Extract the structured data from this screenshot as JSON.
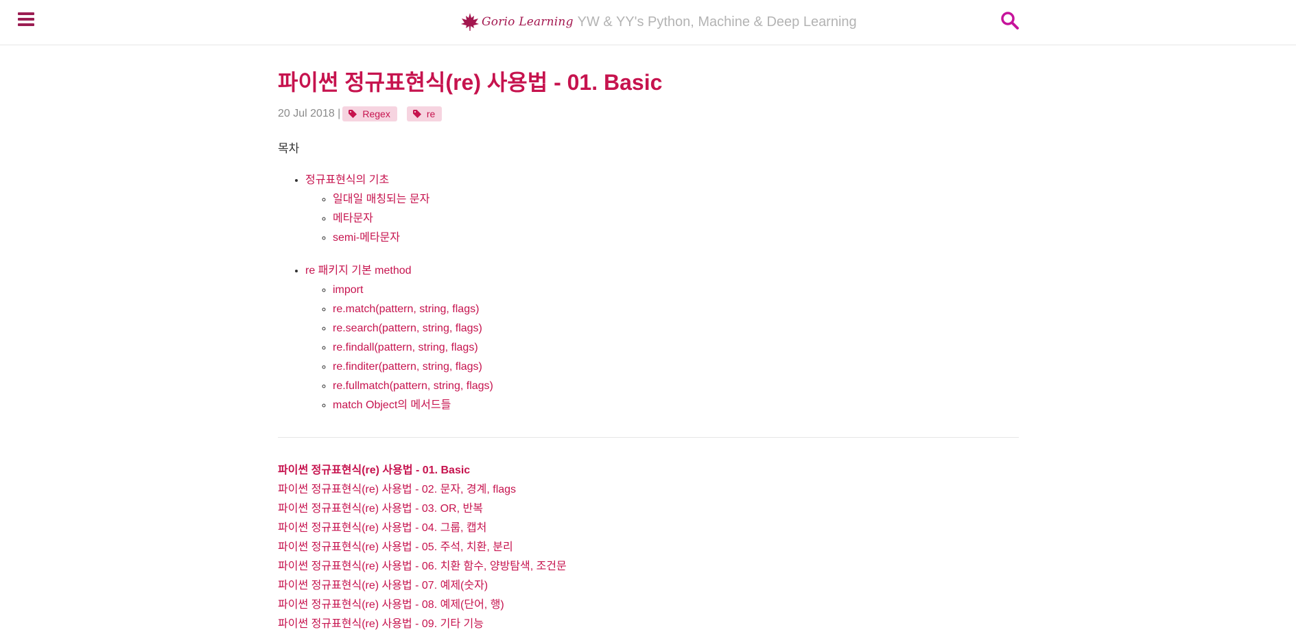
{
  "header": {
    "logo_text": "Gorio Learning",
    "site_description": "YW & YY's Python, Machine & Deep Learning",
    "menu_icon": "hamburger-menu-icon",
    "search_icon": "search-icon",
    "accent_color": "#c6134e"
  },
  "post": {
    "title": "파이썬 정규표현식(re) 사용법 - 01. Basic",
    "date": "20 Jul 2018 |",
    "tags": [
      "Regex",
      "re"
    ]
  },
  "toc": {
    "heading": "목차",
    "sections": [
      {
        "label": "정규표현식의 기초",
        "items": [
          "일대일 매칭되는 문자",
          "메타문자",
          "semi-메타문자"
        ]
      },
      {
        "label": "re 패키지 기본 method",
        "items": [
          "import",
          "re.match(pattern, string, flags)",
          "re.search(pattern, string, flags)",
          "re.findall(pattern, string, flags)",
          "re.finditer(pattern, string, flags)",
          "re.fullmatch(pattern, string, flags)",
          "match Object의 메서드들"
        ]
      }
    ]
  },
  "series": {
    "posts": [
      "파이썬 정규표현식(re) 사용법 - 01. Basic",
      "파이썬 정규표현식(re) 사용법 - 02. 문자, 경계, flags",
      "파이썬 정규표현식(re) 사용법 - 03. OR, 반복",
      "파이썬 정규표현식(re) 사용법 - 04. 그룹, 캡처",
      "파이썬 정규표현식(re) 사용법 - 05. 주석, 치환, 분리",
      "파이썬 정규표현식(re) 사용법 - 06. 치환 함수, 양방탐색, 조건문",
      "파이썬 정규표현식(re) 사용법 - 07. 예제(숫자)",
      "파이썬 정규표현식(re) 사용법 - 08. 예제(단어, 행)",
      "파이썬 정규표현식(re) 사용법 - 09. 기타 기능"
    ]
  }
}
